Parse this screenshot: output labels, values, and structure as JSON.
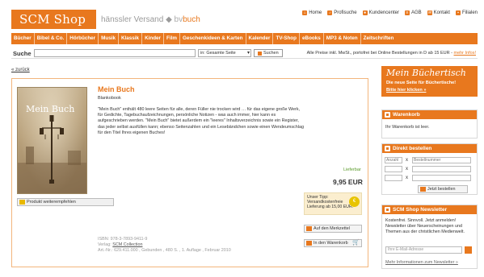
{
  "header": {
    "logo": "SCM Shop",
    "partner1": "hänssler Versand",
    "partner2_a": "bv",
    "partner2_b": "buch",
    "topnav": [
      "Home",
      "Profisuche",
      "Kundencenter",
      "AGB",
      "Kontakt",
      "Filialen"
    ]
  },
  "catnav": [
    "Bücher",
    "Bibel & Co.",
    "Hörbücher",
    "Musik",
    "Klassik",
    "Kinder",
    "Film",
    "Geschenkideen & Karten",
    "Kalender",
    "TV-Shop",
    "eBooks",
    "MP3 & Noten",
    "Zeitschriften"
  ],
  "search": {
    "label": "Suche",
    "value": "",
    "scope": "in: Gesamte Seite",
    "button": "Suchen",
    "info": "Alle Preise inkl. MwSt., portofrei bei Online Bestellungen in D ab 15 EUR -",
    "info_link": "mehr Infos!"
  },
  "back_link": "« zurück",
  "product": {
    "cover_title": "Mein Buch",
    "title": "Mein Buch",
    "type": "Blankobook",
    "description": "\"Mein Buch\" enthält 480 leere Seiten für alle, deren Füller nie trocken wird … für das eigene große Werk, für Gedichte, Tagebuchaufzeichnungen, persönliche Notizen - was auch immer, hier kann es aufgeschrieben werden. \"Mein Buch\" bietet außerdem ein \"leeres\" Inhaltsverzeichnis sowie ein Register, das jeder selbst ausfüllen kann; ebenso Seitenzahlen und ein Lesebändchen sowie einen Wendeumschlag für den Titel Ihres eigenen Buches!",
    "availability": "Lieferbar",
    "price": "9,95 EUR",
    "tip_1": "Unser Tipp:",
    "tip_2": "Versandkostenfreie",
    "tip_3": "Lieferung ab 15,00 EUR.",
    "recommend": "Produkt weiterempfehlen",
    "wishlist": "Auf den Merkzettel",
    "cart": "In den Warenkorb",
    "isbn": "ISBN: 978-3-7893-9411-9",
    "publisher_label": "Verlag:",
    "publisher": "SCM Collection",
    "artnr": "Art.-Nr.: 629.411.000 , Gebunden , 480 S. , 1. Auflage , Februar 2010"
  },
  "banner": {
    "big": "Mein Büchertisch",
    "line1": "Die neue Seite für Büchertische!",
    "line2": "Bitte hier klicken »"
  },
  "cart_panel": {
    "title": "Warenkorb",
    "text": "Ihr Warenkorb ist leer."
  },
  "order_panel": {
    "title": "Direkt bestellen",
    "qty_placeholder": "Anzahl",
    "nr_placeholder": "Bestellnummer",
    "x": "x",
    "button": "Jetzt bestellen"
  },
  "news_panel": {
    "title": "SCM Shop Newsletter",
    "text": "Kostenfrei. Sinnvoll. Jetzt anmelden! Newsletter über Neuerscheinungen und Themen aus der christlichen Medienwelt.",
    "email_placeholder": "Ihre E-Mail-Adresse",
    "more": "Mehr Informationen zum Newsletter »"
  }
}
